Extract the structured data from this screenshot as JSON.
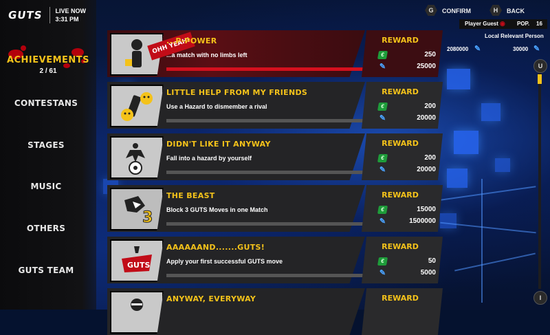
{
  "header": {
    "logo": "GUTS",
    "live_label": "LIVE NOW",
    "time": "3:31 PM"
  },
  "sidebar": {
    "section_title": "ACHIEVEMENTS",
    "progress": "2 / 61",
    "items": [
      {
        "label": "CONTESTANS"
      },
      {
        "label": "STAGES"
      },
      {
        "label": "MUSIC"
      },
      {
        "label": "OTHERS"
      },
      {
        "label": "GUTS TEAM"
      }
    ]
  },
  "top_right": {
    "confirm_key": "G",
    "confirm_label": "CONFIRM",
    "back_key": "H",
    "back_label": "BACK",
    "player_name": "Player Guest",
    "pop_label": "POP.",
    "pop_value": "16",
    "person_label": "Local Relevant Person",
    "stat_left": "2080000",
    "stat_right": "30000"
  },
  "scroll": {
    "up_key": "U",
    "down_key": "I"
  },
  "achievements": [
    {
      "name": "...P-POWER",
      "description": "...a match with no limbs left",
      "reward_label": "REWARD",
      "cash": "250",
      "xp": "25000",
      "progress": 1.0,
      "badge": "OHH YEAH!"
    },
    {
      "name": "LITTLE HELP FROM MY FRIENDS",
      "description": "Use a Hazard to dismember a rival",
      "reward_label": "REWARD",
      "cash": "200",
      "xp": "20000",
      "progress": 0.0
    },
    {
      "name": "DIDN'T LIKE IT ANYWAY",
      "description": "Fall into a hazard by yourself",
      "reward_label": "REWARD",
      "cash": "200",
      "xp": "20000",
      "progress": 0.0
    },
    {
      "name": "THE BEAST",
      "description": "Block 3 GUTS Moves in one Match",
      "reward_label": "REWARD",
      "cash": "15000",
      "xp": "1500000",
      "progress": 0.0
    },
    {
      "name": "AAAAAAND.......GUTS!",
      "description": "Apply your first successful GUTS move",
      "reward_label": "REWARD",
      "cash": "50",
      "xp": "5000",
      "progress": 0.0
    },
    {
      "name": "ANYWAY, EVERYWAY",
      "description": "",
      "reward_label": "REWARD",
      "cash": "",
      "xp": "",
      "progress": 0.0
    }
  ],
  "icons": {
    "cash": "cash-icon",
    "xp": "xp-icon"
  },
  "colors": {
    "accent": "#f4c21a",
    "active_red": "#d4101e",
    "card": "#242426"
  }
}
